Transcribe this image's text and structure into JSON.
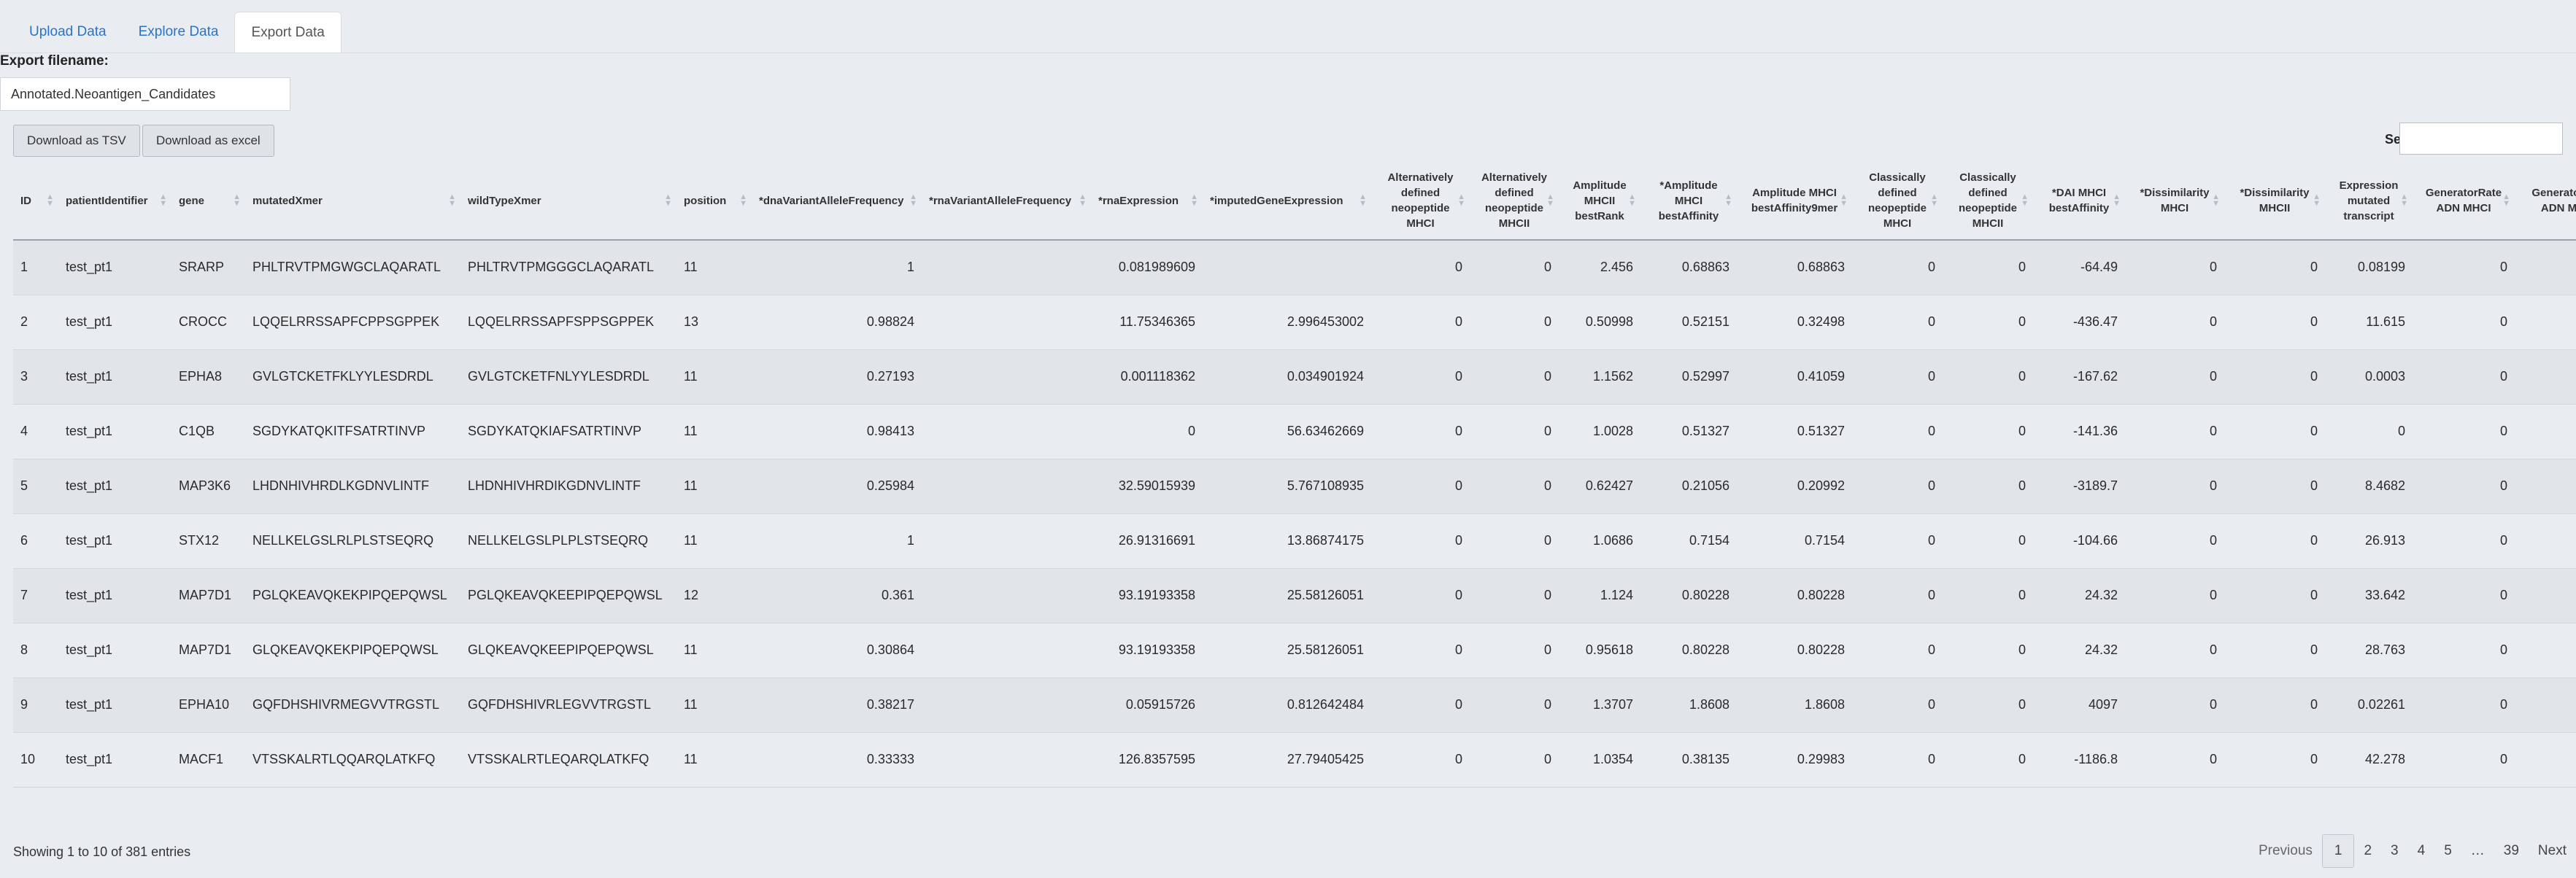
{
  "tabs": [
    {
      "label": "Upload Data",
      "active": false
    },
    {
      "label": "Explore Data",
      "active": false
    },
    {
      "label": "Export Data",
      "active": true
    }
  ],
  "export": {
    "label": "Export filename:",
    "filename": "Annotated.Neoantigen_Candidates",
    "tsv_button": "Download as TSV",
    "excel_button": "Download as excel"
  },
  "search": {
    "label": "Search:",
    "value": ""
  },
  "table": {
    "columns": [
      "ID",
      "patientIdentifier",
      "gene",
      "mutatedXmer",
      "wildTypeXmer",
      "position",
      "*dnaVariantAlleleFrequency",
      "*rnaVariantAlleleFrequency",
      "*rnaExpression",
      "*imputedGeneExpression",
      "Alternatively defined neopeptide MHCI",
      "Alternatively defined neopeptide MHCII",
      "Amplitude MHCII bestRank",
      "*Amplitude MHCI bestAffinity",
      "Amplitude MHCI bestAffinity9mer",
      "Classically defined neopeptide MHCI",
      "Classically defined neopeptide MHCII",
      "*DAI MHCI bestAffinity",
      "*Dissimilarity MHCI",
      "*Dissimilarity MHCII",
      "Expression mutated transcript",
      "GeneratorRate ADN MHCI",
      "GeneratorRate ADN MHCII"
    ],
    "rows": [
      [
        "1",
        "test_pt1",
        "SRARP",
        "PHLTRVTPMGWGCLAQARATL",
        "PHLTRVTPMGGGCLAQARATL",
        "11",
        "1",
        "",
        "0.081989609",
        "",
        "0",
        "0",
        "2.456",
        "0.68863",
        "0.68863",
        "0",
        "0",
        "-64.49",
        "0",
        "0",
        "0.08199",
        "0",
        ""
      ],
      [
        "2",
        "test_pt1",
        "CROCC",
        "LQQELRRSSAPFCPPSGPPEK",
        "LQQELRRSSAPFSPPSGPPEK",
        "13",
        "0.98824",
        "",
        "11.75346365",
        "2.996453002",
        "0",
        "0",
        "0.50998",
        "0.52151",
        "0.32498",
        "0",
        "0",
        "-436.47",
        "0",
        "0",
        "11.615",
        "0",
        ""
      ],
      [
        "3",
        "test_pt1",
        "EPHA8",
        "GVLGTCKETFKLYYLESDRDL",
        "GVLGTCKETFNLYYLESDRDL",
        "11",
        "0.27193",
        "",
        "0.001118362",
        "0.034901924",
        "0",
        "0",
        "1.1562",
        "0.52997",
        "0.41059",
        "0",
        "0",
        "-167.62",
        "0",
        "0",
        "0.0003",
        "0",
        ""
      ],
      [
        "4",
        "test_pt1",
        "C1QB",
        "SGDYKATQKITFSATRTINVP",
        "SGDYKATQKIAFSATRTINVP",
        "11",
        "0.98413",
        "",
        "0",
        "56.63462669",
        "0",
        "0",
        "1.0028",
        "0.51327",
        "0.51327",
        "0",
        "0",
        "-141.36",
        "0",
        "0",
        "0",
        "0",
        ""
      ],
      [
        "5",
        "test_pt1",
        "MAP3K6",
        "LHDNHIVHRDLKGDNVLINTF",
        "LHDNHIVHRDIKGDNVLINTF",
        "11",
        "0.25984",
        "",
        "32.59015939",
        "5.767108935",
        "0",
        "0",
        "0.62427",
        "0.21056",
        "0.20992",
        "0",
        "0",
        "-3189.7",
        "0",
        "0",
        "8.4682",
        "0",
        ""
      ],
      [
        "6",
        "test_pt1",
        "STX12",
        "NELLKELGSLRLPLSTSEQRQ",
        "NELLKELGSLPLPLSTSEQRQ",
        "11",
        "1",
        "",
        "26.91316691",
        "13.86874175",
        "0",
        "0",
        "1.0686",
        "0.7154",
        "0.7154",
        "0",
        "0",
        "-104.66",
        "0",
        "0",
        "26.913",
        "0",
        ""
      ],
      [
        "7",
        "test_pt1",
        "MAP7D1",
        "PGLQKEAVQKEKPIPQEPQWSL",
        "PGLQKEAVQKEEPIPQEPQWSL",
        "12",
        "0.361",
        "",
        "93.19193358",
        "25.58126051",
        "0",
        "0",
        "1.124",
        "0.80228",
        "0.80228",
        "0",
        "0",
        "24.32",
        "0",
        "0",
        "33.642",
        "0",
        ""
      ],
      [
        "8",
        "test_pt1",
        "MAP7D1",
        "GLQKEAVQKEKPIPQEPQWSL",
        "GLQKEAVQKEEPIPQEPQWSL",
        "11",
        "0.30864",
        "",
        "93.19193358",
        "25.58126051",
        "0",
        "0",
        "0.95618",
        "0.80228",
        "0.80228",
        "0",
        "0",
        "24.32",
        "0",
        "0",
        "28.763",
        "0",
        ""
      ],
      [
        "9",
        "test_pt1",
        "EPHA10",
        "GQFDHSHIVRMEGVVTRGSTL",
        "GQFDHSHIVRLEGVVTRGSTL",
        "11",
        "0.38217",
        "",
        "0.05915726",
        "0.812642484",
        "0",
        "0",
        "1.3707",
        "1.8608",
        "1.8608",
        "0",
        "0",
        "4097",
        "0",
        "0",
        "0.02261",
        "0",
        ""
      ],
      [
        "10",
        "test_pt1",
        "MACF1",
        "VTSSKALRTLQQARQLATKFQ",
        "VTSSKALRTLEQARQLATKFQ",
        "11",
        "0.33333",
        "",
        "126.8357595",
        "27.79405425",
        "0",
        "0",
        "1.0354",
        "0.38135",
        "0.29983",
        "0",
        "0",
        "-1186.8",
        "0",
        "0",
        "42.278",
        "0",
        ""
      ]
    ]
  },
  "footer": {
    "info": "Showing 1 to 10 of 381 entries",
    "pagination": [
      "Previous",
      "1",
      "2",
      "3",
      "4",
      "5",
      "…",
      "39",
      "Next"
    ],
    "current_page": "1"
  }
}
